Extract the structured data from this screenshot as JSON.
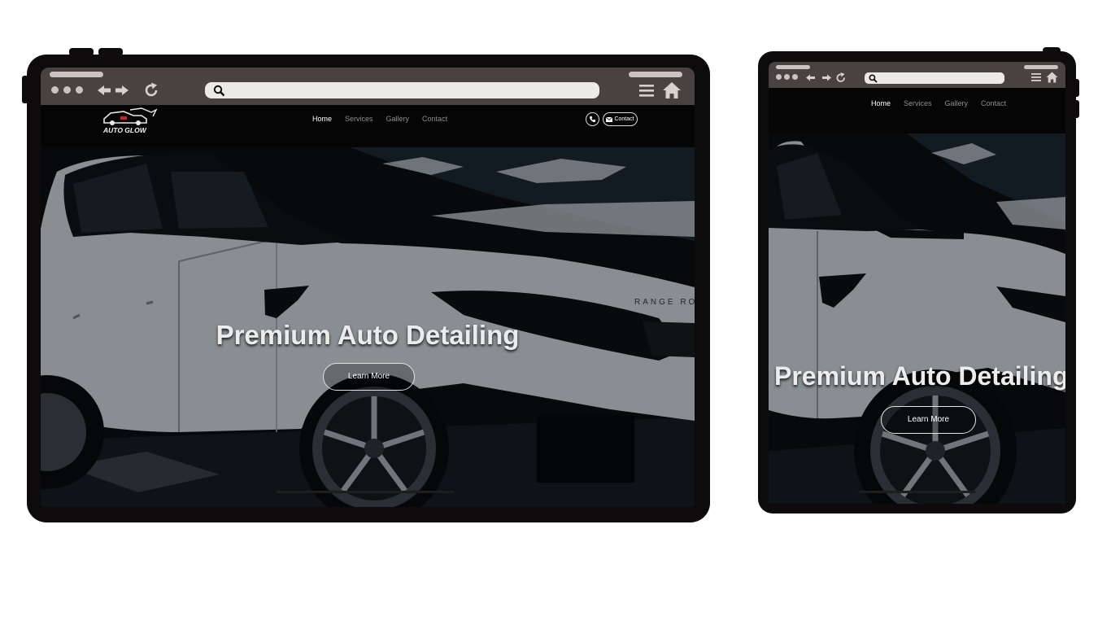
{
  "brand": {
    "logo_text": "AUTO GLOW"
  },
  "nav": {
    "items": [
      {
        "label": "Home",
        "active": true
      },
      {
        "label": "Services",
        "active": false
      },
      {
        "label": "Gallery",
        "active": false
      },
      {
        "label": "Contact",
        "active": false
      }
    ]
  },
  "header_actions": {
    "phone_icon": "phone-icon",
    "contact_label": "Contact",
    "contact_icon": "envelope-icon"
  },
  "hero": {
    "title": "Premium Auto Detailing",
    "cta_label": "Learn More",
    "background": "white SUV (Range Rover) photo, dark overlay",
    "car_badge": "RANGE RO"
  },
  "browser_icons": [
    "window-dots-icon",
    "back-arrow-icon",
    "forward-arrow-icon",
    "reload-icon",
    "search-icon",
    "menu-icon",
    "home-icon"
  ],
  "colors": {
    "frame": "#0e0b0c",
    "toolbar": "#4a4141",
    "address_bar": "#edeae6",
    "page_bg": "#050505",
    "nav_active": "#ffffff",
    "nav_inactive": "#8e8e8e"
  }
}
